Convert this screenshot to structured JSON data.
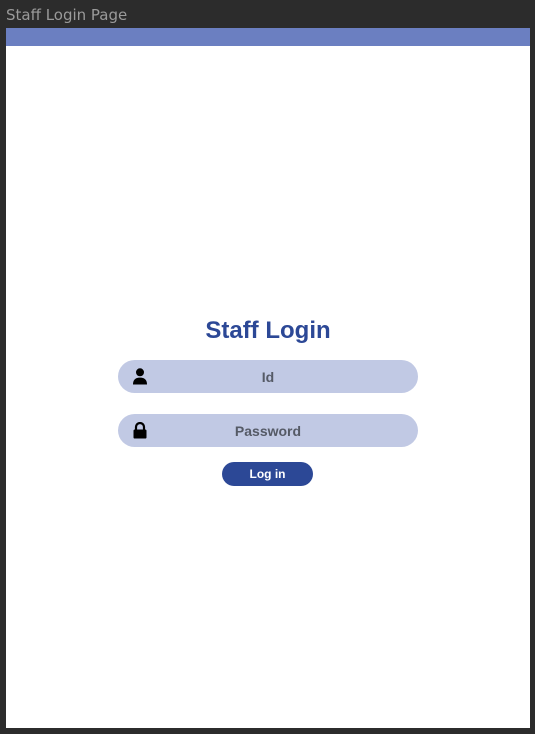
{
  "window": {
    "title": "Staff Login Page"
  },
  "colors": {
    "accent_bar": "#6b7fc1",
    "primary": "#2c4896",
    "field_background": "#c1c9e4"
  },
  "login": {
    "title": "Staff Login",
    "id_field": {
      "icon": "user-icon",
      "placeholder": "Id",
      "value": ""
    },
    "password_field": {
      "icon": "lock-icon",
      "placeholder": "Password",
      "value": ""
    },
    "submit_label": "Log in"
  }
}
